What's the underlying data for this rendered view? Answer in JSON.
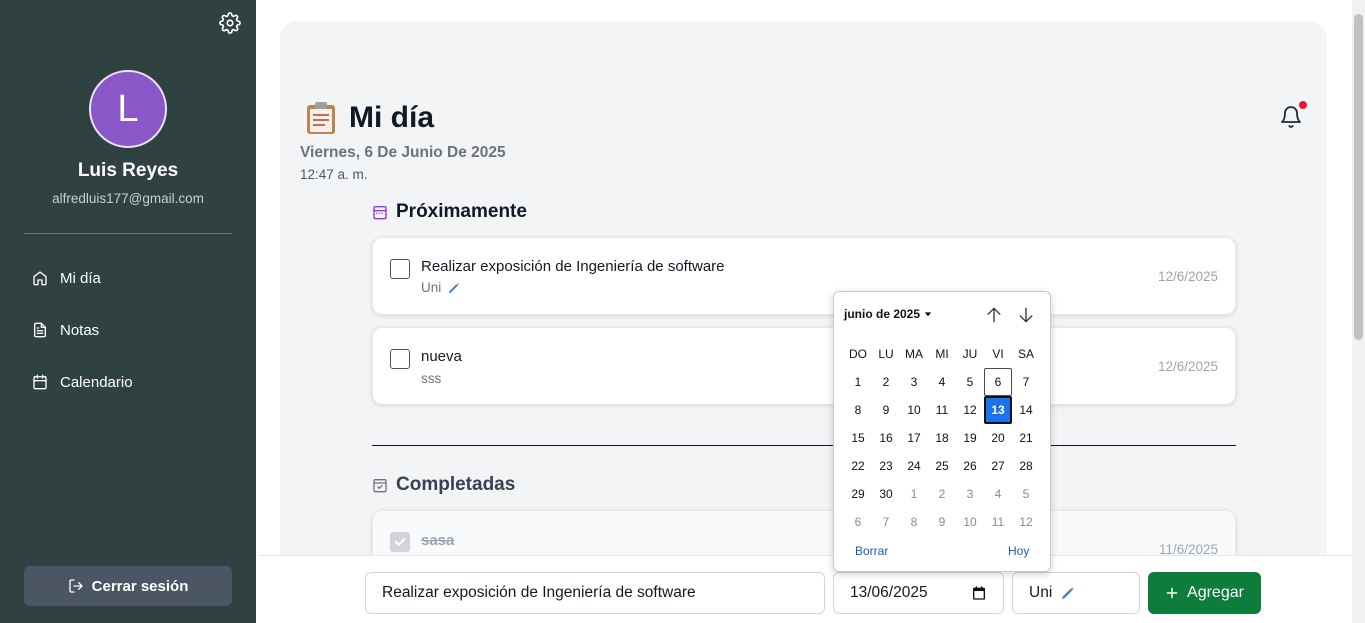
{
  "sidebar": {
    "avatar_letter": "L",
    "user_name": "Luis Reyes",
    "user_email": "alfredluis177@gmail.com",
    "nav": [
      {
        "label": "Mi día",
        "icon": "home-icon"
      },
      {
        "label": "Notas",
        "icon": "document-icon"
      },
      {
        "label": "Calendario",
        "icon": "calendar-icon"
      }
    ],
    "logout_label": "Cerrar sesión"
  },
  "header": {
    "title": "Mi día",
    "date": "Viernes, 6 De Junio De 2025",
    "time": "12:47 a. m."
  },
  "upcoming": {
    "title": "Próximamente",
    "tasks": [
      {
        "title": "Realizar exposición de Ingeniería de software",
        "subtitle": "Uni",
        "date": "12/6/2025"
      },
      {
        "title": "nueva",
        "subtitle": "sss",
        "date": "12/6/2025"
      }
    ]
  },
  "completed": {
    "title": "Completadas",
    "tasks": [
      {
        "title": "sasa",
        "date": "11/6/2025"
      }
    ]
  },
  "form": {
    "task_value": "Realizar exposición de Ingeniería de software",
    "date_value": "13/06/2025",
    "category_value": "Uni",
    "add_label": "Agregar"
  },
  "datepicker": {
    "month_label": "junio de 2025",
    "weekdays": [
      "DO",
      "LU",
      "MA",
      "MI",
      "JU",
      "VI",
      "SA"
    ],
    "days": [
      {
        "d": "1"
      },
      {
        "d": "2"
      },
      {
        "d": "3"
      },
      {
        "d": "4"
      },
      {
        "d": "5"
      },
      {
        "d": "6",
        "today": true
      },
      {
        "d": "7"
      },
      {
        "d": "8"
      },
      {
        "d": "9"
      },
      {
        "d": "10"
      },
      {
        "d": "11"
      },
      {
        "d": "12"
      },
      {
        "d": "13",
        "selected": true
      },
      {
        "d": "14"
      },
      {
        "d": "15"
      },
      {
        "d": "16"
      },
      {
        "d": "17"
      },
      {
        "d": "18"
      },
      {
        "d": "19"
      },
      {
        "d": "20"
      },
      {
        "d": "21"
      },
      {
        "d": "22"
      },
      {
        "d": "23"
      },
      {
        "d": "24"
      },
      {
        "d": "25"
      },
      {
        "d": "26"
      },
      {
        "d": "27"
      },
      {
        "d": "28"
      },
      {
        "d": "29"
      },
      {
        "d": "30"
      },
      {
        "d": "1",
        "other": true
      },
      {
        "d": "2",
        "other": true
      },
      {
        "d": "3",
        "other": true
      },
      {
        "d": "4",
        "other": true
      },
      {
        "d": "5",
        "other": true
      },
      {
        "d": "6",
        "other": true
      },
      {
        "d": "7",
        "other": true
      },
      {
        "d": "8",
        "other": true
      },
      {
        "d": "9",
        "other": true
      },
      {
        "d": "10",
        "other": true
      },
      {
        "d": "11",
        "other": true
      },
      {
        "d": "12",
        "other": true
      }
    ],
    "clear_label": "Borrar",
    "today_label": "Hoy"
  },
  "colors": {
    "sidebar_bg": "#2f4141",
    "avatar_bg": "#8a57c9",
    "add_button": "#0e7c3a",
    "selected_day": "#1a73e8",
    "notification_dot": "#e11d2c"
  }
}
